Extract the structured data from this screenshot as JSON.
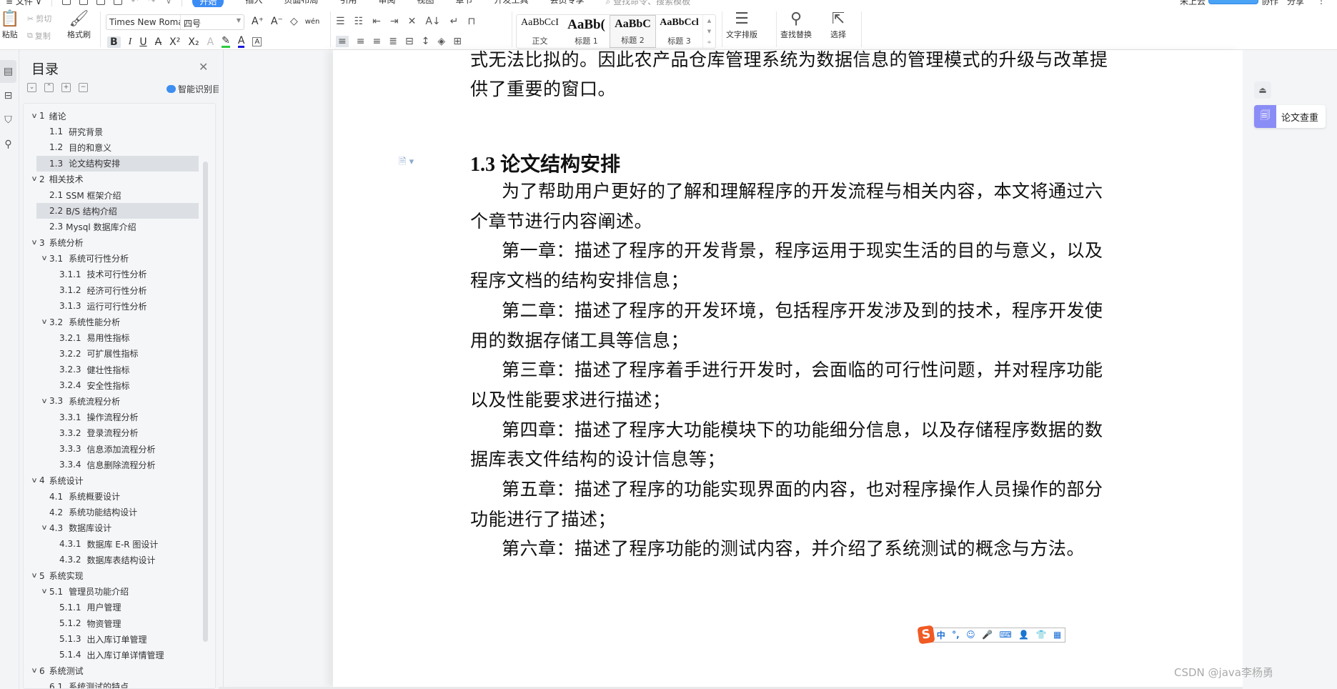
{
  "tabrow": {
    "file_menu": "≡ 文件 ∨",
    "tabs": [
      "开始",
      "插入",
      "页面布局",
      "引用",
      "审阅",
      "视图",
      "章节",
      "开发工具",
      "会员专享"
    ],
    "active_tab": "开始",
    "command_search": "查找命令、搜索模板",
    "right_items": [
      "未上云",
      "协作",
      "分享"
    ]
  },
  "ribbon": {
    "clipboard": {
      "paste": "粘贴",
      "cut": "剪切",
      "copy": "复制",
      "format_painter": "格式刷"
    },
    "font_name": "Times New Roma",
    "font_size": "四号",
    "pinyin_glyph": "wén",
    "styles": [
      {
        "sample": "AaBbCcI",
        "label": "正文",
        "kind": "normal"
      },
      {
        "sample": "AaBb(",
        "label": "标题 1",
        "kind": "h1"
      },
      {
        "sample": "AaBbC",
        "label": "标题 2",
        "kind": "h2"
      },
      {
        "sample": "AaBbCcl",
        "label": "标题 3",
        "kind": "h3"
      }
    ],
    "selected_style": "标题 2",
    "text_layout": "文字排版",
    "find_replace": "查找替换",
    "select": "选择"
  },
  "toc": {
    "title": "目录",
    "smart_label": "智能识别目录",
    "items": [
      {
        "num": "1",
        "text": "绪论",
        "level": 1,
        "expanded": true
      },
      {
        "num": "1.1",
        "text": "研究背景",
        "level": 2
      },
      {
        "num": "1.2",
        "text": "目的和意义",
        "level": 2
      },
      {
        "num": "1.3",
        "text": "论文结构安排",
        "level": 2,
        "selected": true
      },
      {
        "num": "2",
        "text": "相关技术",
        "level": 1,
        "expanded": true
      },
      {
        "num": "2.1",
        "text": "SSM 框架介绍",
        "level": 2,
        "tight": true
      },
      {
        "num": "2.2",
        "text": "B/S 结构介绍",
        "level": 2,
        "tight": true,
        "selected": true
      },
      {
        "num": "2.3",
        "text": "Mysql 数据库介绍",
        "level": 2,
        "tight": true
      },
      {
        "num": "3",
        "text": "系统分析",
        "level": 1,
        "expanded": true
      },
      {
        "num": "3.1",
        "text": "系统可行性分析",
        "level": 2,
        "expanded": true
      },
      {
        "num": "3.1.1",
        "text": "技术可行性分析",
        "level": 3
      },
      {
        "num": "3.1.2",
        "text": "经济可行性分析",
        "level": 3
      },
      {
        "num": "3.1.3",
        "text": "运行可行性分析",
        "level": 3
      },
      {
        "num": "3.2",
        "text": "系统性能分析",
        "level": 2,
        "expanded": true
      },
      {
        "num": "3.2.1",
        "text": "易用性指标",
        "level": 3
      },
      {
        "num": "3.2.2",
        "text": "可扩展性指标",
        "level": 3
      },
      {
        "num": "3.2.3",
        "text": "健壮性指标",
        "level": 3
      },
      {
        "num": "3.2.4",
        "text": "安全性指标",
        "level": 3
      },
      {
        "num": "3.3",
        "text": "系统流程分析",
        "level": 2,
        "expanded": true
      },
      {
        "num": "3.3.1",
        "text": "操作流程分析",
        "level": 3
      },
      {
        "num": "3.3.2",
        "text": "登录流程分析",
        "level": 3
      },
      {
        "num": "3.3.3",
        "text": "信息添加流程分析",
        "level": 3
      },
      {
        "num": "3.3.4",
        "text": "信息删除流程分析",
        "level": 3
      },
      {
        "num": "4",
        "text": "系统设计",
        "level": 1,
        "expanded": true
      },
      {
        "num": "4.1",
        "text": "系统概要设计",
        "level": 2,
        "leaf_under_expander": true
      },
      {
        "num": "4.2",
        "text": "系统功能结构设计",
        "level": 2,
        "leaf_under_expander": true
      },
      {
        "num": "4.3",
        "text": "数据库设计",
        "level": 2,
        "expanded": true
      },
      {
        "num": "4.3.1",
        "text": "数据库 E-R 图设计",
        "level": 3
      },
      {
        "num": "4.3.2",
        "text": "数据库表结构设计",
        "level": 3
      },
      {
        "num": "5",
        "text": "系统实现",
        "level": 1,
        "expanded": true
      },
      {
        "num": "5.1",
        "text": "管理员功能介绍",
        "level": 2,
        "expanded": true
      },
      {
        "num": "5.1.1",
        "text": "用户管理",
        "level": 3
      },
      {
        "num": "5.1.2",
        "text": "物资管理",
        "level": 3
      },
      {
        "num": "5.1.3",
        "text": "出入库订单管理",
        "level": 3
      },
      {
        "num": "5.1.4",
        "text": "出入库订单详情管理",
        "level": 3
      },
      {
        "num": "6",
        "text": "系统测试",
        "level": 1,
        "expanded": true
      },
      {
        "num": "6.1",
        "text": "系统测试的特点",
        "level": 2,
        "leaf_under_expander": true
      }
    ]
  },
  "document": {
    "lines": [
      "式无法比拟的。因此农产品仓库管理系统为数据信息的管理模式的升级与改革提",
      "供了重要的窗口。"
    ],
    "heading": "1.3  论文结构安排",
    "body_lines": [
      {
        "text": "为了帮助用户更好的了解和理解程序的开发流程与相关内容，本文将通过六",
        "indent": true
      },
      {
        "text": "个章节进行内容阐述。",
        "indent": false
      },
      {
        "text": "第一章：描述了程序的开发背景，程序运用于现实生活的目的与意义，以及",
        "indent": true
      },
      {
        "text": "程序文档的结构安排信息；",
        "indent": false
      },
      {
        "text": "第二章：描述了程序的开发环境，包括程序开发涉及到的技术，程序开发使",
        "indent": true
      },
      {
        "text": "用的数据存储工具等信息；",
        "indent": false
      },
      {
        "text": "第三章：描述了程序着手进行开发时，会面临的可行性问题，并对程序功能",
        "indent": true
      },
      {
        "text": "以及性能要求进行描述；",
        "indent": false
      },
      {
        "text": "第四章：描述了程序大功能模块下的功能细分信息，以及存储程序数据的数",
        "indent": true
      },
      {
        "text": "据库表文件结构的设计信息等；",
        "indent": false
      },
      {
        "text": "第五章：描述了程序的功能实现界面的内容，也对程序操作人员操作的部分",
        "indent": true
      },
      {
        "text": "功能进行了描述；",
        "indent": false
      },
      {
        "text": "第六章：描述了程序功能的测试内容，并介绍了系统测试的概念与方法。",
        "indent": true
      }
    ]
  },
  "right_rail": {
    "plagiarism_check": "论文查重"
  },
  "ime": {
    "logo": "S",
    "mode": "中"
  },
  "watermark": "CSDN @java李杨勇",
  "colors": {
    "accent": "#3c8cf6",
    "plagiarism_badge": "#8b8df6",
    "ime_logo": "#f05a24",
    "toc_selected": "#dcdfe4"
  }
}
